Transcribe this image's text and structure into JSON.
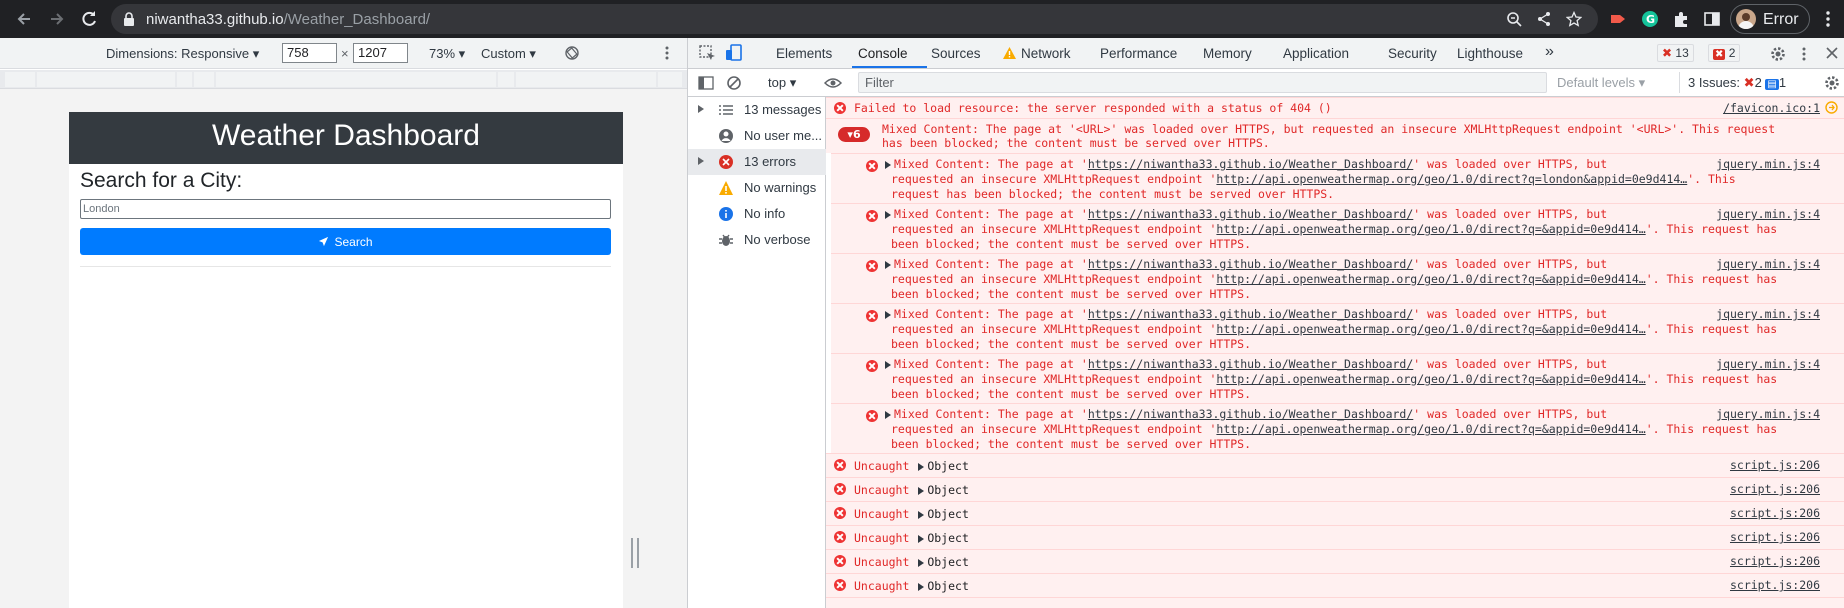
{
  "browser": {
    "url_host": "niwantha33.github.io",
    "url_path": "/Weather_Dashboard/",
    "profile_label": "Error"
  },
  "device_toolbar": {
    "dimensions_label": "Dimensions: Responsive",
    "width": "758",
    "times": "×",
    "height": "1207",
    "zoom": "73%",
    "throttle": "Custom"
  },
  "page": {
    "header_title": "Weather Dashboard",
    "search_title": "Search for a City:",
    "city_input_value": "London",
    "search_button_label": "Search"
  },
  "devtools": {
    "tabs": [
      "Elements",
      "Console",
      "Sources",
      "Network",
      "Performance",
      "Memory",
      "Application",
      "Security",
      "Lighthouse"
    ],
    "more_tabs": "»",
    "error_count": "13",
    "warning_count": "2",
    "context": "top",
    "filter_placeholder": "Filter",
    "levels_label": "Default levels",
    "issues_label": "3 Issues:",
    "issues_errors": "2",
    "issues_info": "1"
  },
  "sidebar": {
    "items": [
      {
        "label": "13 messages",
        "icon": "list-icon"
      },
      {
        "label": "No user me...",
        "icon": "user-icon"
      },
      {
        "label": "13 errors",
        "icon": "error-icon"
      },
      {
        "label": "No warnings",
        "icon": "warning-icon"
      },
      {
        "label": "No info",
        "icon": "info-icon"
      },
      {
        "label": "No verbose",
        "icon": "bug-icon"
      }
    ]
  },
  "console": {
    "favicon_error": "Failed to load resource: the server responded with a status of 404 ()",
    "favicon_src": "/favicon.ico:1",
    "group_count": "6",
    "group_line1": "Mixed Content: The page at '<URL>' was loaded over HTTPS, but requested an insecure XMLHttpRequest endpoint '<URL>'. This request",
    "group_line2": "has been blocked; the content must be served over HTTPS.",
    "mixed_prefix": "Mixed Content: The page at '",
    "mixed_page_url": "https://niwantha33.github.io/Weather_Dashboard/",
    "mixed_mid": "' was loaded over HTTPS, but",
    "mixed_req": "requested an insecure XMLHttpRequest endpoint '",
    "mixed_endpoint_london": "http://api.openweathermap.org/geo/1.0/direct?q=london&appid=0e9d414…",
    "mixed_tail_london": "'. This",
    "mixed_last_london": "request has been blocked; the content must be served over HTTPS.",
    "mixed_endpoint_empty": "http://api.openweathermap.org/geo/1.0/direct?q=&appid=0e9d414…",
    "mixed_tail_empty": "'. This request has",
    "mixed_last_empty": "been blocked; the content must be served over HTTPS.",
    "mixed_src": "jquery.min.js:4",
    "uncaught_label": "Uncaught",
    "uncaught_obj": "Object",
    "uncaught_src": "script.js:206"
  }
}
